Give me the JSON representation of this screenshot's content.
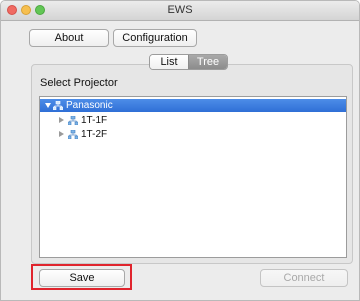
{
  "window": {
    "title": "EWS"
  },
  "toolbar": {
    "about_label": "About",
    "configuration_label": "Configuration"
  },
  "view_toggle": {
    "list_label": "List",
    "tree_label": "Tree",
    "selected": "Tree"
  },
  "panel": {
    "select_label": "Select Projector"
  },
  "tree": {
    "root": {
      "label": "Panasonic",
      "expanded": true,
      "selected": true
    },
    "children": [
      {
        "label": "1T-1F",
        "expanded": false
      },
      {
        "label": "1T-2F",
        "expanded": false
      }
    ]
  },
  "footer": {
    "save_label": "Save",
    "connect_label": "Connect",
    "connect_enabled": false
  },
  "colors": {
    "selection": "#3b7ddf",
    "highlight_border": "#e0242d"
  },
  "icons": {
    "window_controls": [
      "close-icon",
      "minimize-icon",
      "zoom-icon"
    ],
    "tree_node": "network-group-icon"
  }
}
